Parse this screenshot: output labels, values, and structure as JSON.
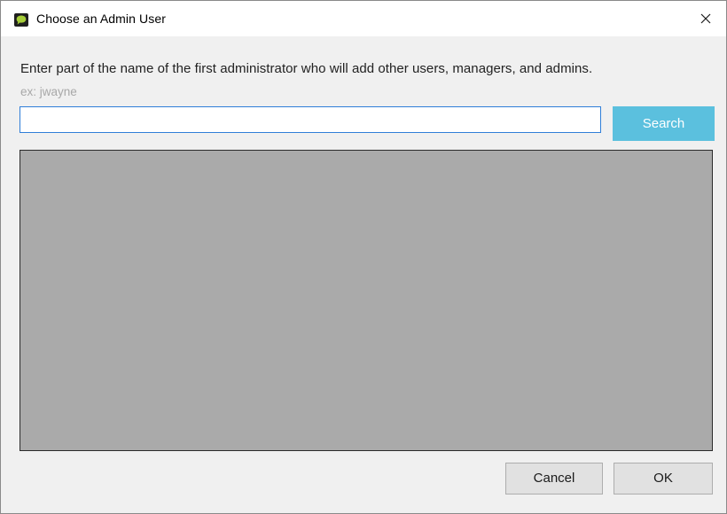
{
  "window": {
    "title": "Choose an Admin User"
  },
  "dialog": {
    "instructions": "Enter part of the name of the first administrator who will add other users, managers, and admins.",
    "example": "ex: jwayne",
    "search_value": "",
    "search_label": "Search",
    "cancel_label": "Cancel",
    "ok_label": "OK"
  },
  "icons": {
    "app": "chat-bubble-icon",
    "close": "close-icon"
  },
  "colors": {
    "search_button_bg": "#5bc0de",
    "input_focus_border": "#2f7ed8",
    "results_bg": "#aaaaaa",
    "app_icon_bubble": "#a6ce39"
  }
}
